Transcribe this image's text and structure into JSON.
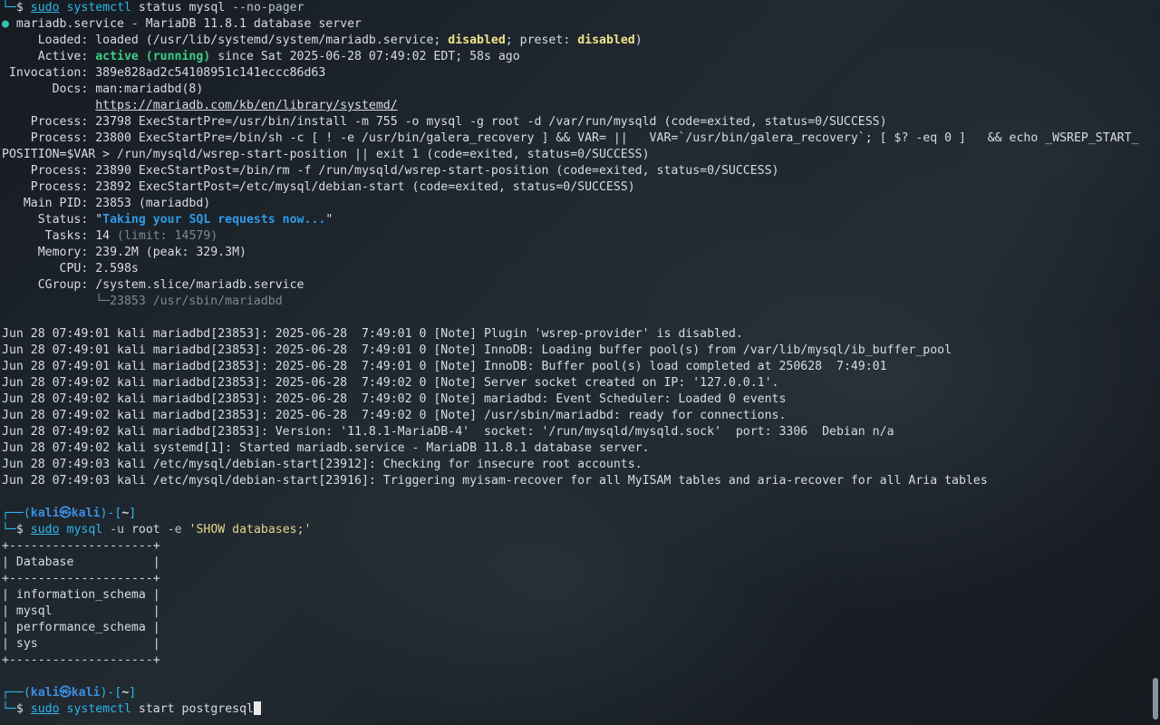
{
  "terminal": {
    "prompt": {
      "open": "┌──(",
      "user": "kali",
      "at": "㉿",
      "host": "kali",
      "mid": ")-[",
      "cwd": "~",
      "close": "]",
      "corner": "└─",
      "symbol": "$"
    },
    "cmd1": {
      "sudo": "sudo",
      "prog": "systemctl",
      "args": " status mysql ",
      "opt": "--no-pager"
    },
    "status": {
      "dot": "●",
      "header": " mariadb.service - MariaDB 11.8.1 database server",
      "loaded_label": "     Loaded: ",
      "loaded_pre": "loaded (/usr/lib/systemd/system/mariadb.service; ",
      "loaded_disabled": "disabled",
      "loaded_mid": "; preset: ",
      "loaded_preset": "disabled",
      "loaded_post": ")",
      "active_label": "     Active: ",
      "active_state": "active (running)",
      "active_rest": " since Sat 2025-06-28 07:49:02 EDT; 58s ago",
      "invocation": " Invocation: 389e828ad2c54108951c141eccc86d63",
      "docs1": "       Docs: man:mariadbd(8)",
      "docs2_pad": "             ",
      "docs2": "https://mariadb.com/kb/en/library/systemd/",
      "proc1": "    Process: 23798 ExecStartPre=/usr/bin/install -m 755 -o mysql -g root -d /var/run/mysqld (code=exited, status=0/SUCCESS)",
      "proc2": "    Process: 23800 ExecStartPre=/bin/sh -c [ ! -e /usr/bin/galera_recovery ] && VAR= ||   VAR=`/usr/bin/galera_recovery`; [ $? -eq 0 ]   && echo _WSREP_START_",
      "proc2b": "POSITION=$VAR > /run/mysqld/wsrep-start-position || exit 1 (code=exited, status=0/SUCCESS)",
      "proc3": "    Process: 23890 ExecStartPost=/bin/rm -f /run/mysqld/wsrep-start-position (code=exited, status=0/SUCCESS)",
      "proc4": "    Process: 23892 ExecStartPost=/etc/mysql/debian-start (code=exited, status=0/SUCCESS)",
      "mainpid": "   Main PID: 23853 (mariadbd)",
      "status_label": "     Status: ",
      "status_q": "\"",
      "status_text": "Taking your SQL requests now...",
      "tasks_label": "      Tasks: 14 ",
      "tasks_limit": "(limit: 14579)",
      "memory": "     Memory: 239.2M (peak: 329.3M)",
      "cpu": "        CPU: 2.598s",
      "cgroup": "     CGroup: /system.slice/mariadb.service",
      "cgroup_child": "             └─23853 /usr/sbin/mariadbd"
    },
    "journal": [
      "Jun 28 07:49:01 kali mariadbd[23853]: 2025-06-28  7:49:01 0 [Note] Plugin 'wsrep-provider' is disabled.",
      "Jun 28 07:49:01 kali mariadbd[23853]: 2025-06-28  7:49:01 0 [Note] InnoDB: Loading buffer pool(s) from /var/lib/mysql/ib_buffer_pool",
      "Jun 28 07:49:01 kali mariadbd[23853]: 2025-06-28  7:49:01 0 [Note] InnoDB: Buffer pool(s) load completed at 250628  7:49:01",
      "Jun 28 07:49:02 kali mariadbd[23853]: 2025-06-28  7:49:02 0 [Note] Server socket created on IP: '127.0.0.1'.",
      "Jun 28 07:49:02 kali mariadbd[23853]: 2025-06-28  7:49:02 0 [Note] mariadbd: Event Scheduler: Loaded 0 events",
      "Jun 28 07:49:02 kali mariadbd[23853]: 2025-06-28  7:49:02 0 [Note] /usr/sbin/mariadbd: ready for connections.",
      "Jun 28 07:49:02 kali mariadbd[23853]: Version: '11.8.1-MariaDB-4'  socket: '/run/mysqld/mysqld.sock'  port: 3306  Debian n/a",
      "Jun 28 07:49:02 kali systemd[1]: Started mariadb.service - MariaDB 11.8.1 database server.",
      "Jun 28 07:49:03 kali /etc/mysql/debian-start[23912]: Checking for insecure root accounts.",
      "Jun 28 07:49:03 kali /etc/mysql/debian-start[23916]: Triggering myisam-recover for all MyISAM tables and aria-recover for all Aria tables"
    ],
    "cmd2": {
      "sudo": "sudo",
      "prog": "mysql",
      "opt_u": " -u",
      "arg_root": " root",
      "opt_e": " -e",
      "query": " 'SHOW databases;'"
    },
    "table": {
      "border": "+--------------------+",
      "header": "| Database           |",
      "rows": [
        "| information_schema |",
        "| mysql              |",
        "| performance_schema |",
        "| sys                |"
      ]
    },
    "cmd3": {
      "sudo": "sudo",
      "prog": "systemctl",
      "args": " start postgresql"
    }
  }
}
